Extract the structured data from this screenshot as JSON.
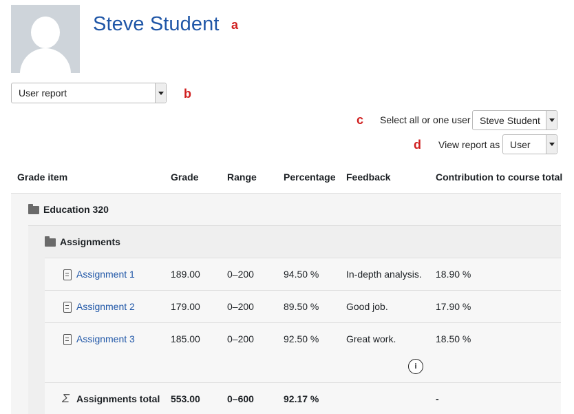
{
  "profile": {
    "name": "Steve Student"
  },
  "annotations": {
    "a": "a",
    "b": "b",
    "c": "c",
    "d": "d"
  },
  "report_selector": {
    "value": "User report"
  },
  "user_select": {
    "label": "Select all or one user",
    "value": "Steve Student"
  },
  "view_as": {
    "label": "View report as",
    "value": "User"
  },
  "table": {
    "headers": [
      "Grade item",
      "Grade",
      "Range",
      "Percentage",
      "Feedback",
      "Contribution to course total"
    ],
    "course": "Education 320",
    "category": "Assignments",
    "rows": [
      {
        "item": "Assignment 1",
        "grade": "189.00",
        "range": "0–200",
        "percentage": "94.50 %",
        "feedback": "In-depth analysis.",
        "contribution": "18.90 %"
      },
      {
        "item": "Assignment 2",
        "grade": "179.00",
        "range": "0–200",
        "percentage": "89.50 %",
        "feedback": "Good job.",
        "contribution": "17.90 %"
      },
      {
        "item": "Assignment 3",
        "grade": "185.00",
        "range": "0–200",
        "percentage": "92.50 %",
        "feedback": "Great work.",
        "contribution": "18.50 %"
      }
    ],
    "info_icon": "i",
    "total": {
      "item": "Assignments total",
      "grade": "553.00",
      "range": "0–600",
      "percentage": "92.17 %",
      "feedback": "",
      "contribution": "-"
    }
  },
  "colors": {
    "link": "#1f56a7",
    "annotation": "#d01f1f"
  },
  "icons": [
    "user-avatar-icon",
    "folder-icon",
    "assignment-icon",
    "info-icon",
    "sigma-icon",
    "chevron-down-icon"
  ]
}
